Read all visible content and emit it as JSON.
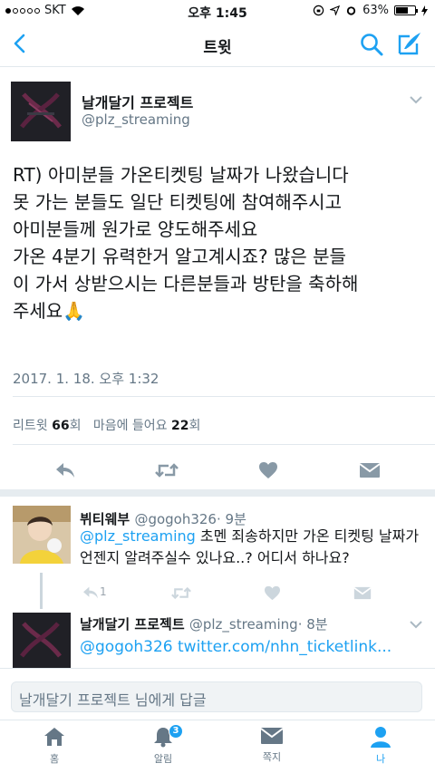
{
  "status_bar": {
    "carrier": "SKT",
    "time": "오후 1:45",
    "battery": "63%",
    "battery_level": 0.63
  },
  "nav": {
    "title": "트윗",
    "back_icon": "chevron-left-icon",
    "search_icon": "search-icon",
    "compose_icon": "compose-icon",
    "accent": "#1da1f2"
  },
  "tweet": {
    "author_name": "날개달기 프로젝트",
    "author_handle": "@plz_streaming",
    "text": "RT) 아미분들 가온티켓팅 날짜가 나왔습니다\n못 가는 분들도 일단 티켓팅에 참여해주시고\n아미분들께 원가로 양도해주세요\n가온 4분기 유력한거 알고계시죠? 많은 분들\n이 가서 상받으시는 다른분들과 방탄을 축하해\n주세요🙏",
    "timestamp": "2017. 1. 18. 오후 1:32",
    "retweet_label": "리트윗",
    "retweet_count": "66",
    "retweet_unit": "회",
    "like_label": "마음에 들어요",
    "like_count": "22",
    "like_unit": "회"
  },
  "replies": [
    {
      "name": "뷔티웨부",
      "handle": "@gogoh326",
      "time": "· 9분",
      "mention": "@plz_streaming",
      "text": " 초멘 죄송하지만 가온 티켓팅 날짜가 언젠지 알려주실수 있나요..? 어디서 하나요?",
      "reply_count": "1"
    },
    {
      "name": "날개달기 프로젝트",
      "handle": "@plz_streaming",
      "time": "· 8분",
      "text": "@gogoh326 twitter.com/nhn_ticketlink..."
    }
  ],
  "composer": {
    "placeholder": "날개달기 프로젝트 님에게 답글"
  },
  "tabs": [
    {
      "label": "홈",
      "icon": "home-icon"
    },
    {
      "label": "알림",
      "icon": "bell-icon",
      "badge": "3"
    },
    {
      "label": "쪽지",
      "icon": "envelope-icon"
    },
    {
      "label": "나",
      "icon": "profile-icon"
    }
  ]
}
